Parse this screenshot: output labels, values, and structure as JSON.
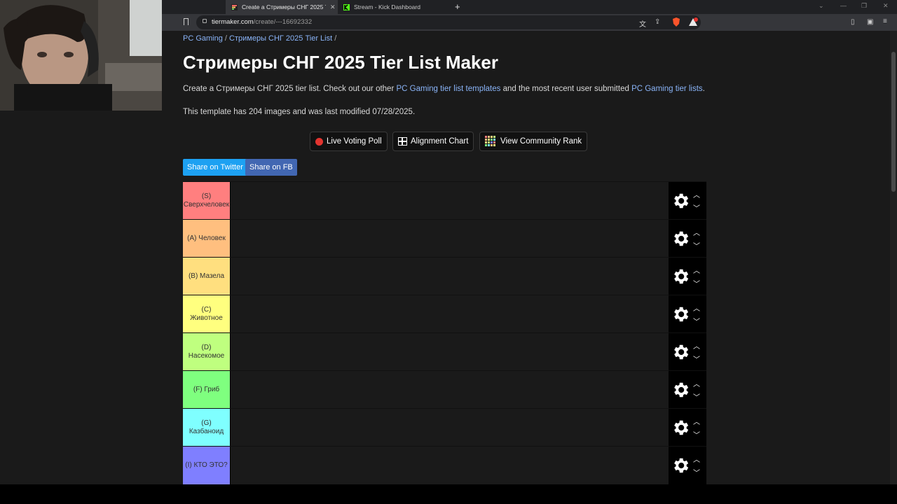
{
  "browser": {
    "tabs": [
      {
        "title": "Create a Стримеры СНГ 2025 Ti",
        "active": true
      },
      {
        "title": "Stream - Kick Dashboard",
        "active": false
      }
    ],
    "url_domain": "tiermaker.com",
    "url_path": "/create/---16692332"
  },
  "page": {
    "breadcrumb": {
      "item1": "PC Gaming",
      "sep": " / ",
      "item2": "Стримеры СНГ 2025 Tier List",
      "trail": " /"
    },
    "title": "Стримеры СНГ 2025 Tier List Maker",
    "desc": {
      "prefix": "Create a Стримеры СНГ 2025 tier list. Check out our other ",
      "link1": "PC Gaming tier list templates",
      "middle": " and the most recent user submitted ",
      "link2": "PC Gaming tier lists",
      "suffix": "."
    },
    "info": "This template has 204 images and was last modified 07/28/2025.",
    "buttons": {
      "live_poll": "Live Voting Poll",
      "alignment": "Alignment Chart",
      "community_rank": "View Community Rank",
      "share_twitter": "Share on Twitter",
      "share_fb": "Share on FB"
    },
    "tiers": [
      {
        "label": "(S) Сверхчеловек",
        "color": "#ff7f7f"
      },
      {
        "label": "(A) Человек",
        "color": "#ffbf7f"
      },
      {
        "label": "(B) Мазела",
        "color": "#ffdf7f"
      },
      {
        "label": "(C) Животное",
        "color": "#ffff7f"
      },
      {
        "label": "(D) Насекомое",
        "color": "#bfff7f"
      },
      {
        "label": "(F) Гриб",
        "color": "#7fff7f"
      },
      {
        "label": "(G) Казбаноид",
        "color": "#7fffff"
      },
      {
        "label": "(I) КТО ЭТО?",
        "color": "#7f7fff"
      }
    ]
  },
  "icons": {
    "gear": "gear-icon",
    "up": "chevron-up-icon",
    "down": "chevron-down-icon"
  },
  "colors": {
    "twitter": "#1da1f2",
    "facebook": "#4267b2",
    "link": "#8ab4f8"
  }
}
